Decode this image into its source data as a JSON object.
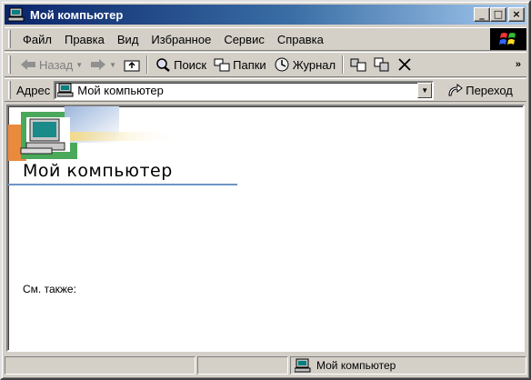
{
  "window": {
    "title": "Мой компьютер",
    "buttons": {
      "minimize": "_",
      "maximize": "□",
      "close": "×"
    }
  },
  "menubar": {
    "items": [
      {
        "label": "Файл"
      },
      {
        "label": "Правка"
      },
      {
        "label": "Вид"
      },
      {
        "label": "Избранное"
      },
      {
        "label": "Сервис"
      },
      {
        "label": "Справка"
      }
    ]
  },
  "toolbar": {
    "back_label": "Назад",
    "search_label": "Поиск",
    "folders_label": "Папки",
    "history_label": "Журнал",
    "more": "»"
  },
  "addressbar": {
    "label": "Адрес",
    "value": "Мой компьютер",
    "go_label": "Переход"
  },
  "content": {
    "title": "Мой компьютер",
    "see_also": "См. также:"
  },
  "statusbar": {
    "zone_text": "Мой компьютер"
  },
  "colors": {
    "titlebar_start": "#0a246a",
    "titlebar_end": "#a6caf0",
    "chrome": "#d4d0c8",
    "title_rule": "#6f95c2"
  }
}
